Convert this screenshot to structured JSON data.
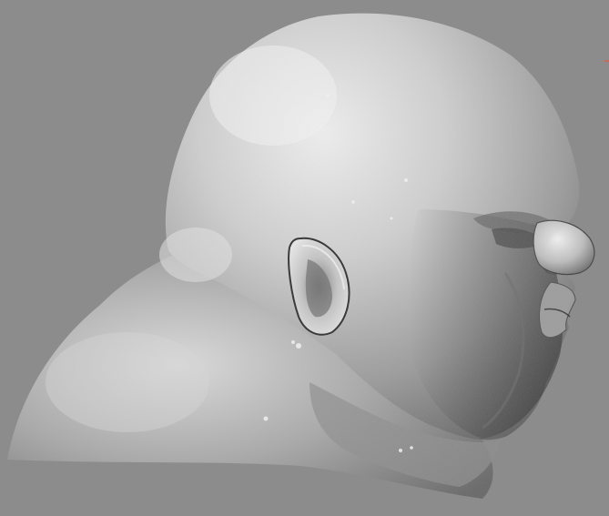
{
  "scene": {
    "subject": "sculpted-bust-side-view",
    "colors": {
      "background": "#8c8c8c",
      "material_light": "#e6e6e6",
      "material_mid": "#b4b4b4",
      "material_dark": "#5a5a5a",
      "edge_dark": "#2e2e2e"
    }
  }
}
